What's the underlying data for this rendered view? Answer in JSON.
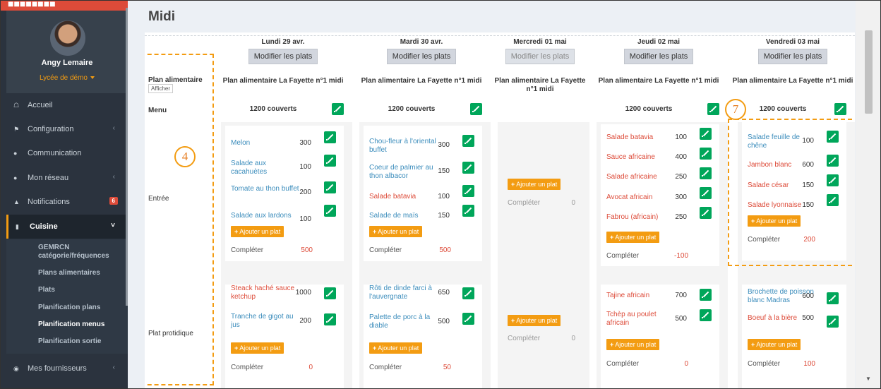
{
  "sidebar": {
    "user": {
      "name": "Angy Lemaire",
      "school": "Lycée de démo"
    },
    "items": [
      {
        "label": "Accueil",
        "icon": "home-icon"
      },
      {
        "label": "Configuration",
        "icon": "bank-icon"
      },
      {
        "label": "Communication",
        "icon": "chat-icon"
      },
      {
        "label": "Mon réseau",
        "icon": "users-icon"
      },
      {
        "label": "Notifications",
        "icon": "bell-icon",
        "badge": "6"
      },
      {
        "label": "Cuisine",
        "icon": "cutlery-icon"
      },
      {
        "label": "Mes fournisseurs",
        "icon": "eye-icon"
      }
    ],
    "submenu": [
      "GEMRCN",
      "catégorie/fréquences",
      "Plans alimentaires",
      "Plats",
      "Planification plans",
      "Planification menus",
      "Planification sortie"
    ]
  },
  "page": {
    "title": "Midi"
  },
  "labels": {
    "plan": "Plan alimentaire",
    "show": "Afficher",
    "menu": "Menu",
    "entree": "Entrée",
    "proteique": "Plat protidique",
    "add": "Ajouter un plat",
    "complete": "Compléter"
  },
  "days": [
    {
      "name": "Lundi 29 avr.",
      "modify": "Modifier les plats",
      "plan": "Plan alimentaire La Fayette n°1 midi",
      "covers": "1200 couverts",
      "entree": [
        {
          "n": "Melon",
          "q": "300",
          "c": "blue"
        },
        {
          "n": "Salade aux cacahuètes",
          "q": "100",
          "c": "blue"
        },
        {
          "n": "Tomate au thon buffet",
          "q": "200",
          "c": "blue"
        },
        {
          "n": "Salade aux lardons",
          "q": "100",
          "c": "blue"
        }
      ],
      "entree_complete": "500",
      "proteique": [
        {
          "n": "Steack haché sauce ketchup",
          "q": "1000",
          "c": "red"
        },
        {
          "n": "Tranche de gigot au jus",
          "q": "200",
          "c": "blue"
        }
      ],
      "proteique_complete": "0"
    },
    {
      "name": "Mardi 30 avr.",
      "modify": "Modifier les plats",
      "plan": "Plan alimentaire La Fayette n°1 midi",
      "covers": "1200 couverts",
      "entree": [
        {
          "n": "Chou-fleur à l'oriental buffet",
          "q": "300",
          "c": "blue"
        },
        {
          "n": "Coeur de palmier au thon albacor",
          "q": "150",
          "c": "blue"
        },
        {
          "n": "Salade batavia",
          "q": "100",
          "c": "red"
        },
        {
          "n": "Salade de maïs",
          "q": "150",
          "c": "blue"
        }
      ],
      "entree_complete": "500",
      "proteique": [
        {
          "n": "Rôti de dinde farci à l'auvergnate",
          "q": "650",
          "c": "blue"
        },
        {
          "n": "Palette de porc à la diable",
          "q": "500",
          "c": "blue"
        }
      ],
      "proteique_complete": "50"
    },
    {
      "name": "Mercredi 01 mai",
      "modify": "Modifier les plats",
      "plan": "Plan alimentaire La Fayette n°1 midi",
      "entree_complete": "0",
      "proteique_complete": "0"
    },
    {
      "name": "Jeudi 02 mai",
      "modify": "Modifier les plats",
      "plan": "Plan alimentaire La Fayette n°1 midi",
      "covers": "1200 couverts",
      "entree": [
        {
          "n": "Salade batavia",
          "q": "100",
          "c": "red"
        },
        {
          "n": "Sauce africaine",
          "q": "400",
          "c": "red"
        },
        {
          "n": "Salade africaine",
          "q": "250",
          "c": "red"
        },
        {
          "n": "Avocat africain",
          "q": "300",
          "c": "red"
        },
        {
          "n": "Fabrou (africain)",
          "q": "250",
          "c": "red"
        }
      ],
      "entree_complete": "-100",
      "proteique": [
        {
          "n": "Tajine africain",
          "q": "700",
          "c": "red"
        },
        {
          "n": "Tchèp au poulet africain",
          "q": "500",
          "c": "red"
        }
      ],
      "proteique_complete": "0"
    },
    {
      "name": "Vendredi 03 mai",
      "modify": "Modifier les plats",
      "plan": "Plan alimentaire La Fayette n°1 midi",
      "covers": "1200 couverts",
      "entree": [
        {
          "n": "Salade feuille de chêne",
          "q": "100",
          "c": "blue"
        },
        {
          "n": "Jambon blanc",
          "q": "600",
          "c": "red"
        },
        {
          "n": "Salade césar",
          "q": "150",
          "c": "red"
        },
        {
          "n": "Salade lyonnaise",
          "q": "150",
          "c": "red"
        }
      ],
      "entree_complete": "200",
      "proteique": [
        {
          "n": "Brochette de poisson blanc Madras",
          "q": "600",
          "c": "blue"
        },
        {
          "n": "Boeuf à la bière",
          "q": "500",
          "c": "red"
        }
      ],
      "proteique_complete": "100"
    }
  ],
  "annotations": {
    "a4": "4",
    "a7": "7"
  },
  "colors": {
    "sidebar": "#2b333e",
    "accent": "#f39c12",
    "green": "#00a65a",
    "link": "#3c8dbc",
    "danger": "#dd4b39"
  }
}
